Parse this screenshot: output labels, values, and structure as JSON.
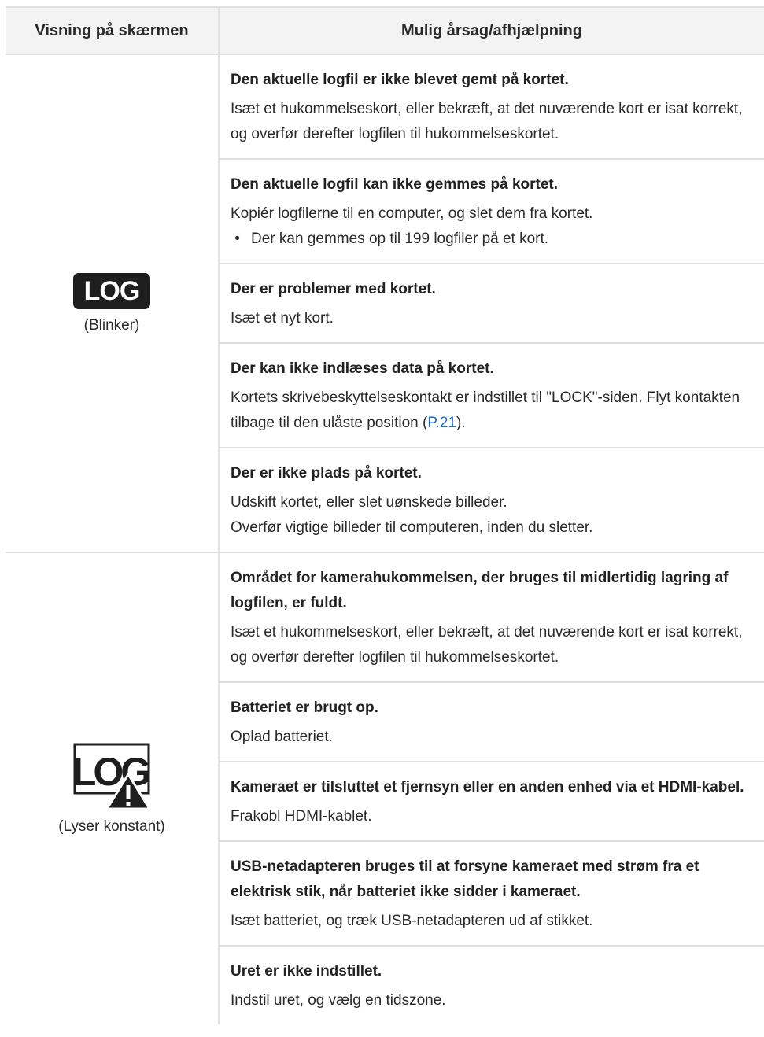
{
  "header": {
    "col1": "Visning på skærmen",
    "col2": "Mulig årsag/afhjælpning"
  },
  "groups": [
    {
      "icon": {
        "name": "log-blinking-icon",
        "text": "LOG"
      },
      "caption": "(Blinker)",
      "rows": [
        {
          "title": "Den aktuelle logfil er ikke blevet gemt på kortet.",
          "body": "Isæt et hukommelseskort, eller bekræft, at det nuværende kort er isat korrekt, og overfør derefter logfilen til hukommelseskortet."
        },
        {
          "title": "Den aktuelle logfil kan ikke gemmes på kortet.",
          "body": "Kopiér logfilerne til en computer, og slet dem fra kortet.",
          "bullet": "Der kan gemmes op til 199 logfiler på et kort."
        },
        {
          "title": "Der er problemer med kortet.",
          "body": "Isæt et nyt kort."
        },
        {
          "title": "Der kan ikke indlæses data på kortet.",
          "body_before": "Kortets skrivebeskyttelseskontakt er indstillet til \"LOCK\"-siden. Flyt kontakten tilbage til den ulåste position (",
          "link": "P.21",
          "body_after": ")."
        },
        {
          "title": "Der er ikke plads på kortet.",
          "body": "Udskift kortet, eller slet uønskede billeder.",
          "body2": "Overfør vigtige billeder til computeren, inden du sletter."
        }
      ]
    },
    {
      "icon": {
        "name": "log-warning-icon",
        "text": "LOG"
      },
      "caption": "(Lyser konstant)",
      "rows": [
        {
          "title": "Området for kamerahukommelsen, der bruges til midlertidig lagring af logfilen, er fuldt.",
          "body": "Isæt et hukommelseskort, eller bekræft, at det nuværende kort er isat korrekt, og overfør derefter logfilen til hukommelseskortet."
        },
        {
          "title": "Batteriet er brugt op.",
          "body": "Oplad batteriet."
        },
        {
          "title": "Kameraet er tilsluttet et fjernsyn eller en anden enhed via et HDMI-kabel.",
          "body": "Frakobl HDMI-kablet."
        },
        {
          "title": "USB-netadapteren bruges til at forsyne kameraet med strøm fra et elektrisk stik, når batteriet ikke sidder i kameraet.",
          "body": "Isæt batteriet, og træk USB-netadapteren ud af stikket."
        },
        {
          "title": "Uret er ikke indstillet.",
          "body": "Indstil uret, og vælg en tidszone."
        }
      ]
    }
  ]
}
